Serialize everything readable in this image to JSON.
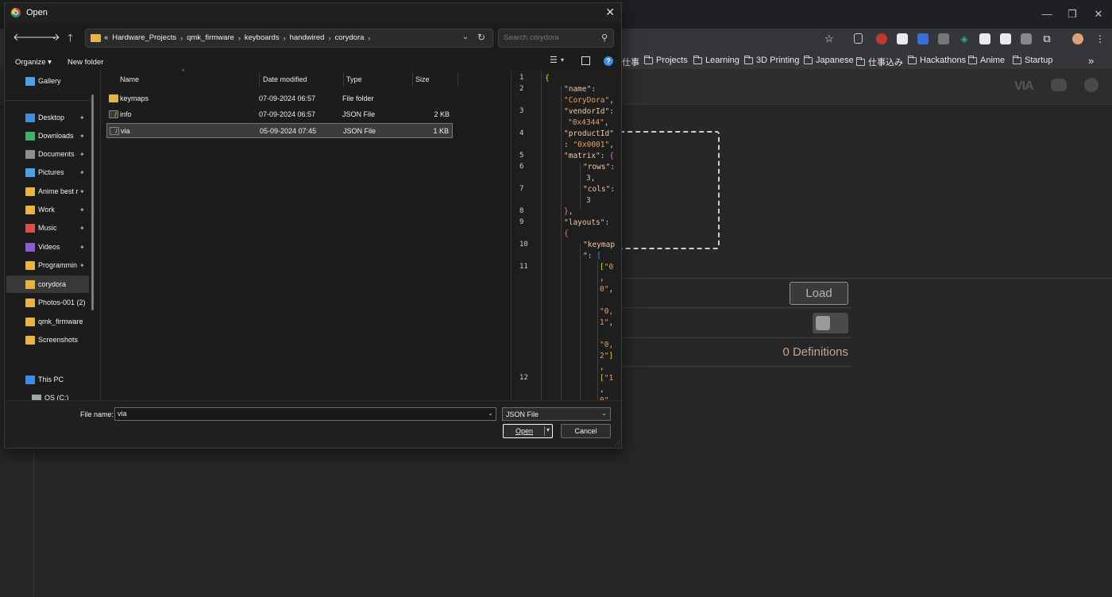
{
  "colors": {
    "accent_folder": "#e8b542",
    "selection": "#3c3c3c",
    "definitions_text": "#c4a890"
  },
  "browser": {
    "window_controls": [
      "—",
      "❐",
      "✕"
    ],
    "toolbar_icons": [
      "star-icon",
      "extension-puzzle-icon",
      "profile-avatar",
      "more-menu-icon"
    ],
    "bookmarks": [
      "仕事",
      "Projects",
      "Learning",
      "3D Printing",
      "Japanese",
      "仕事込み",
      "Hackathons",
      "Anime",
      "Startup"
    ],
    "bookmarks_overflow": "»"
  },
  "app": {
    "load_label": "Load",
    "definitions_label": "0 Definitions"
  },
  "dialog": {
    "title": "Open",
    "close": "✕",
    "breadcrumb": {
      "overflow": "«",
      "items": [
        "Hardware_Projects",
        "qmk_firmware",
        "keyboards",
        "handwired",
        "corydora"
      ]
    },
    "search_placeholder": "Search corydora",
    "commands": {
      "organize": "Organize ▾",
      "new_folder": "New folder"
    },
    "sidebar": {
      "top": {
        "label": "Gallery",
        "icon": "gallery-icon"
      },
      "pinned": [
        {
          "label": "Desktop",
          "icon": "desktop-icon",
          "color": "#3f8fd6"
        },
        {
          "label": "Downloads",
          "icon": "download-icon",
          "color": "#3fb36d"
        },
        {
          "label": "Documents",
          "icon": "documents-icon",
          "color": "#8f8f8f"
        },
        {
          "label": "Pictures",
          "icon": "pictures-icon",
          "color": "#4aa3e8"
        },
        {
          "label": "Anime best r",
          "icon": "folder-icon",
          "color": "#e8b542"
        },
        {
          "label": "Work",
          "icon": "folder-icon",
          "color": "#e8b542"
        },
        {
          "label": "Music",
          "icon": "music-icon",
          "color": "#e0504a"
        },
        {
          "label": "Videos",
          "icon": "videos-icon",
          "color": "#8b5cd6"
        },
        {
          "label": "Programmin",
          "icon": "folder-icon",
          "color": "#e8b542"
        }
      ],
      "recent": [
        {
          "label": "corydora",
          "icon": "folder-icon",
          "color": "#e8b542"
        },
        {
          "label": "Photos-001 (2)",
          "icon": "folder-icon",
          "color": "#e8b542"
        },
        {
          "label": "qmk_firmware",
          "icon": "folder-icon",
          "color": "#e8b542"
        },
        {
          "label": "Screenshots",
          "icon": "folder-icon",
          "color": "#e8b542"
        }
      ],
      "this_pc": "This PC",
      "os_drive": "OS (C:)"
    },
    "columns": [
      "Name",
      "Date modified",
      "Type",
      "Size"
    ],
    "files": [
      {
        "name": "keymaps",
        "date": "07-09-2024 06:57",
        "type": "File folder",
        "size": "",
        "kind": "folder"
      },
      {
        "name": "info",
        "date": "07-09-2024 06:57",
        "type": "JSON File",
        "size": "2 KB",
        "kind": "json"
      },
      {
        "name": "via",
        "date": "05-09-2024 07:45",
        "type": "JSON File",
        "size": "1 KB",
        "kind": "json"
      }
    ],
    "preview_line_numbers": [
      "1",
      "2",
      "3",
      "4",
      "5",
      "6",
      "7",
      "8",
      "9",
      "10",
      "11",
      "12"
    ],
    "file_name_label": "File name:",
    "file_name_value": "via",
    "file_type": "JSON File",
    "open_label": "Open",
    "cancel_label": "Cancel"
  }
}
